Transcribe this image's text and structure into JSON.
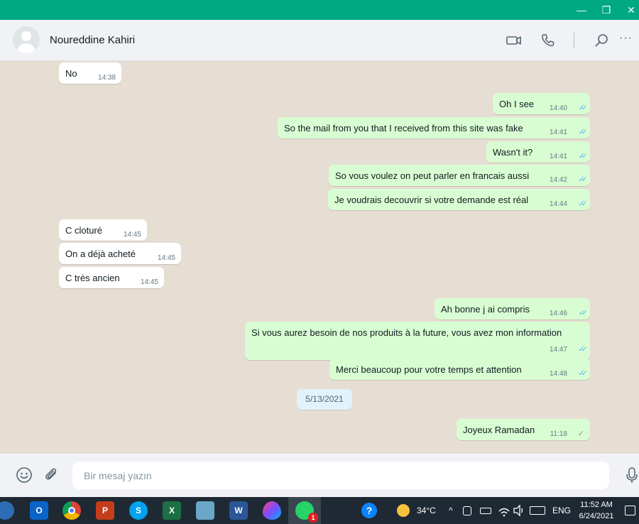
{
  "window": {
    "buttons": {
      "minimize": "—",
      "maximize": "❐",
      "close": "✕"
    }
  },
  "header": {
    "contact_name": "Noureddine Kahiri",
    "icons": [
      "video-call-icon",
      "voice-call-icon",
      "search-icon",
      "more-icon"
    ],
    "more_label": "···"
  },
  "messages": [
    {
      "dir": "in",
      "text": "No",
      "time": "14:38"
    },
    {
      "dir": "out",
      "text": "Oh I see",
      "time": "14:40",
      "status": "read"
    },
    {
      "dir": "out",
      "text": "So the mail from you that I received from this site was fake",
      "time": "14:41",
      "status": "read"
    },
    {
      "dir": "out",
      "text": "Wasn't it?",
      "time": "14:41",
      "status": "read"
    },
    {
      "dir": "out",
      "text": "So vous voulez on peut parler en francais aussi",
      "time": "14:42",
      "status": "read"
    },
    {
      "dir": "out",
      "text": "Je voudrais decouvrir si votre demande est réal",
      "time": "14:44",
      "status": "read"
    },
    {
      "dir": "in",
      "text": "C cloturé",
      "time": "14:45"
    },
    {
      "dir": "in",
      "text": "On a déjà acheté",
      "time": "14:45"
    },
    {
      "dir": "in",
      "text": "C très ancien",
      "time": "14:45"
    },
    {
      "dir": "out",
      "text": "Ah bonne j ai compris",
      "time": "14:46",
      "status": "read"
    },
    {
      "dir": "out",
      "text": "Si vous aurez besoin de nos produits à la future, vous avez mon information",
      "time": "14:47",
      "status": "read"
    },
    {
      "dir": "out",
      "text": "Merci beaucoup pour votre temps et attention",
      "time": "14:48",
      "status": "read"
    },
    {
      "dir": "out",
      "text": "Joyeux Ramadan",
      "time": "11:18",
      "status": "sent"
    }
  ],
  "date_separator": "5/13/2021",
  "composer": {
    "placeholder": "Bir mesaj yazın",
    "icons": [
      "emoji-icon",
      "attach-icon",
      "microphone-icon"
    ]
  },
  "taskbar": {
    "apps": [
      "Outlook",
      "Chrome",
      "PowerPoint",
      "Skype",
      "Excel",
      "Notes",
      "Word",
      "Paint",
      "WhatsApp"
    ],
    "apps_labels": {
      "outlook": "O",
      "powerpoint": "P",
      "skype": "S",
      "excel": "X",
      "word": "W"
    },
    "whatsapp_badge": "1",
    "help_icon": "?",
    "weather": "34°C",
    "tray_chevron": "^",
    "language": "ENG",
    "time": "11:52 AM",
    "date": "6/24/2021"
  }
}
